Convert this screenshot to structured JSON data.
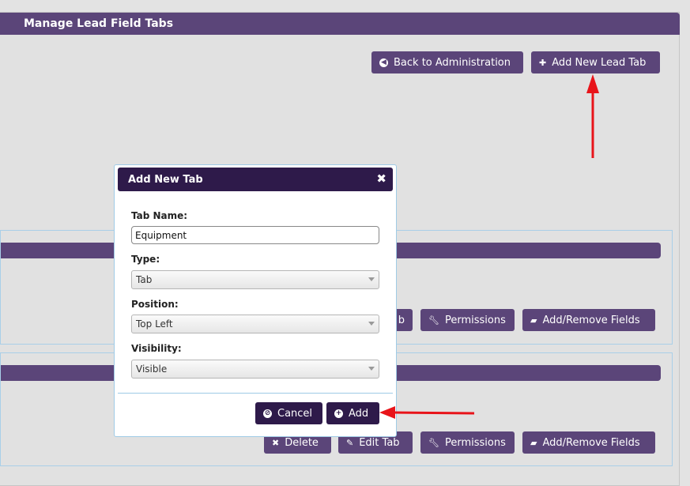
{
  "page": {
    "title": "Manage Lead Field Tabs",
    "back_label": "Back to Administration",
    "add_tab_label": "Add New Lead Tab"
  },
  "tab_rows": [
    {
      "partial_edit_label": "b",
      "permissions_label": "Permissions",
      "add_remove_label": "Add/Remove Fields"
    },
    {
      "delete_label": "Delete",
      "edit_tab_label": "Edit Tab",
      "permissions_label": "Permissions",
      "add_remove_label": "Add/Remove Fields"
    }
  ],
  "dialog": {
    "title": "Add New Tab",
    "close_glyph": "✖",
    "tab_name_label": "Tab Name:",
    "tab_name_value": "Equipment",
    "type_label": "Type:",
    "type_value": "Tab",
    "position_label": "Position:",
    "position_value": "Top Left",
    "visibility_label": "Visibility:",
    "visibility_value": "Visible",
    "cancel_label": "Cancel",
    "add_label": "Add"
  },
  "icons": {
    "back": "arrow-left-circle-icon",
    "plus": "plus-icon",
    "wrench": "wrench-icon",
    "folder": "folder-open-icon",
    "times": "times-icon",
    "pencil": "pencil-icon",
    "ban": "ban-icon",
    "plus_circle": "plus-circle-icon"
  },
  "colors": {
    "brand": "#5b4579",
    "dialog_header": "#2e1a4a",
    "annotation_arrow": "#e8141a"
  }
}
